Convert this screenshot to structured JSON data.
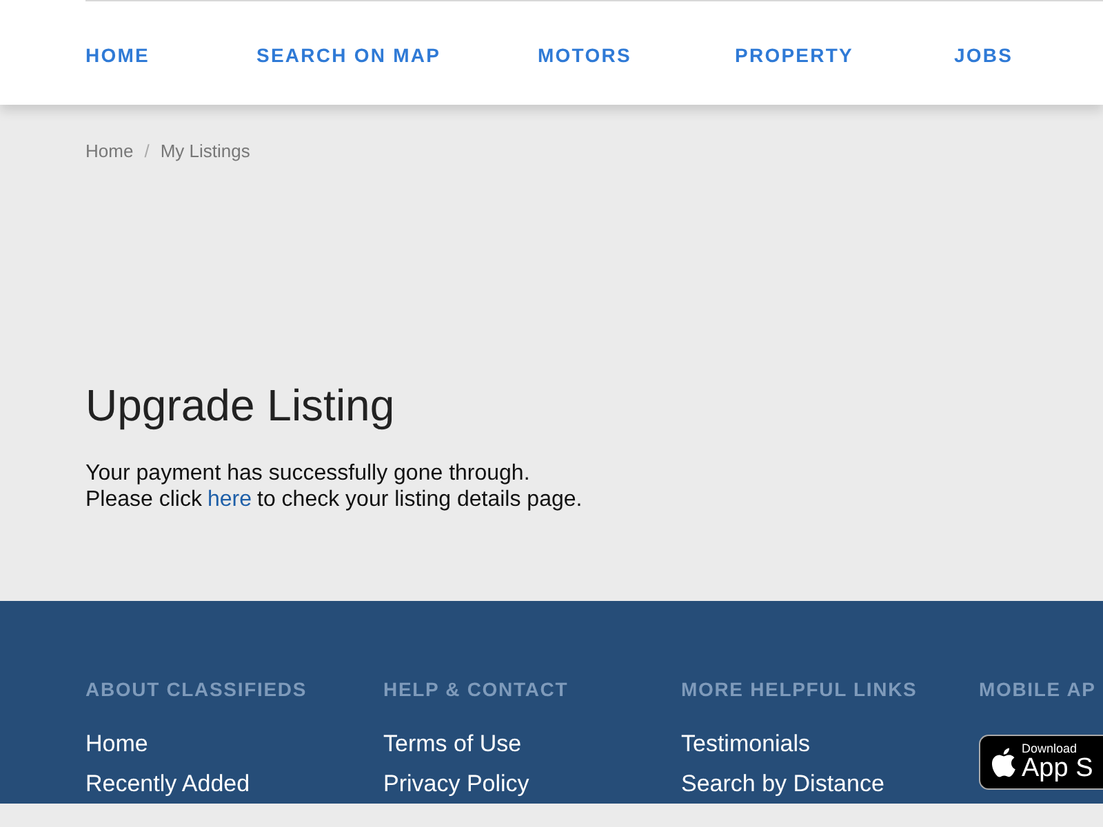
{
  "nav": [
    {
      "label": "HOME"
    },
    {
      "label": "SEARCH ON MAP"
    },
    {
      "label": "MOTORS"
    },
    {
      "label": "PROPERTY"
    },
    {
      "label": "JOBS"
    }
  ],
  "breadcrumb": [
    "Home",
    "My Listings"
  ],
  "breadcrumb_separator": "/",
  "title": "Upgrade Listing",
  "message": {
    "line_1": "Your payment has successfully gone through.",
    "line_2_before": "Please click",
    "link": "here",
    "line_2_after": "to check your listing details page."
  },
  "footer": {
    "columns": [
      {
        "heading": "ABOUT CLASSIFIEDS",
        "links": [
          "Home",
          "Recently Added"
        ]
      },
      {
        "heading": "HELP & CONTACT",
        "links": [
          "Terms of Use",
          "Privacy Policy"
        ]
      },
      {
        "heading": "MORE HELPFUL LINKS",
        "links": [
          "Testimonials",
          "Search by Distance"
        ]
      },
      {
        "heading": "MOBILE AP",
        "badge": {
          "small": "Download",
          "large": "App S"
        }
      }
    ]
  }
}
